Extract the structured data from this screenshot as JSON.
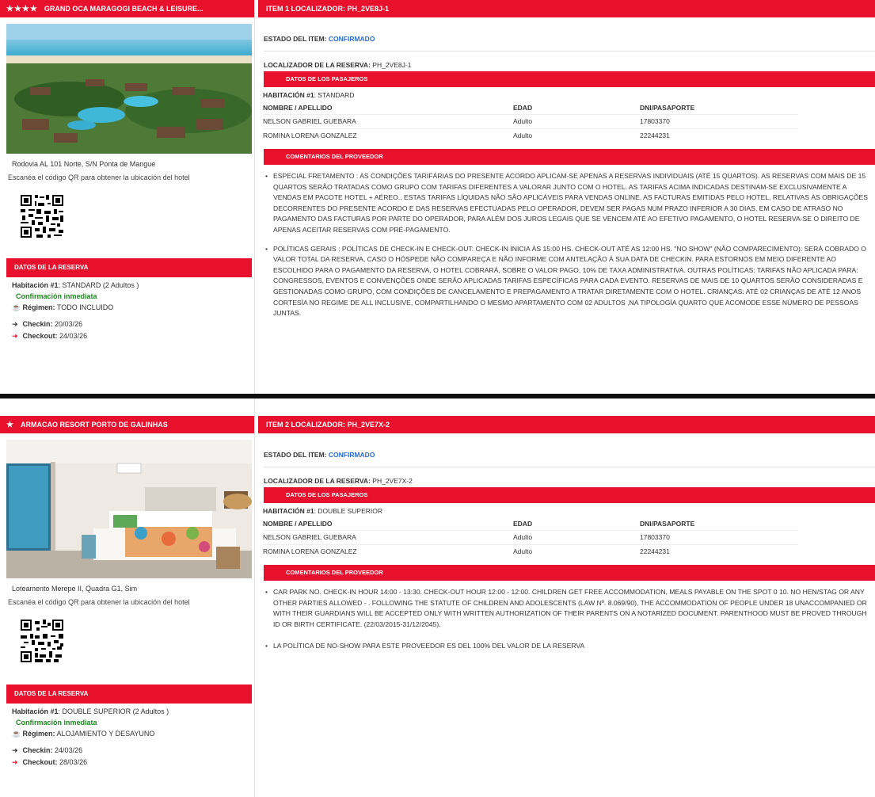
{
  "items": [
    {
      "hotel": {
        "stars": "★★★★",
        "name": "GRAND OCA MARAGOGI BEACH & LEISURE...",
        "address": "Rodovia AL 101 Norte, S/N Ponta de Mangue",
        "qr_note": "Escanéa el código QR para obtener la ubicación del hotel"
      },
      "reservation": {
        "header": "DATOS DE LA RESERVA",
        "habitacion_label": "Habitación",
        "habitacion_num": "#1",
        "habitacion_value": ": STANDARD (2 Adultos )",
        "confirmation": "Confirmación inmediata",
        "regimen_label": "Régimen:",
        "regimen_value": "TODO INCLUIDO",
        "checkin_label": "Checkin:",
        "checkin_value": "20/03/26",
        "checkout_label": "Checkout:",
        "checkout_value": "24/03/26"
      },
      "item_title": "ITEM 1 LOCALIZADOR: PH_2VE8J-1",
      "estado_label": "ESTADO DEL ITEM:",
      "estado_value": "CONFIRMADO",
      "localizador_label": "LOCALIZADOR DE LA RESERVA:",
      "localizador_value": "PH_2VE8J-1",
      "pasajeros_header": "DATOS DE LOS PASAJEROS",
      "room_label": "HABITACIÓN",
      "room_num": "#1",
      "room_value": ": STANDARD",
      "columns": [
        "NOMBRE / APELLIDO",
        "EDAD",
        "DNI/PASAPORTE"
      ],
      "passengers": [
        [
          "NELSON GABRIEL GUEBARA",
          "Adulto",
          "17803370"
        ],
        [
          "ROMINA LORENA GONZALEZ",
          "Adulto",
          "22244231"
        ]
      ],
      "comments_header": "COMENTARIOS DEL PROVEEDOR",
      "comments": [
        "ESPECIAL FRETAMENTO : AS CONDIÇÕES TARIFÁRIAS DO PRESENTE ACORDO APLICAM-SE APENAS A RESERVAS INDIVIDUAIS (ATÉ 15 QUARTOS). AS RESERVAS COM MAIS DE 15 QUARTOS SERÃO TRATADAS COMO GRUPO COM TARIFAS DIFERENTES A VALORAR JUNTO COM O HOTEL. AS TARIFAS ACIMA INDICADAS DESTINAM-SE EXCLUSIVAMENTE A VENDAS EM PACOTE HOTEL + AÉREO.. ESTAS TARIFAS LÍQUIDAS NÃO SÃO APLICÁVEIS PARA VENDAS ONLINE. AS FACTURAS EMITIDAS PELO HOTEL, RELATIVAS ÀS OBRIGAÇÕES DECORRENTES DO PRESENTE ACORDO E DAS RESERVAS EFECTUADAS PELO OPERADOR, DEVEM SER PAGAS NUM PRAZO INFERIOR A 30 DIAS. EM CASO DE ATRASO NO PAGAMENTO DAS FACTURAS POR PARTE DO OPERADOR, PARA ALÉM DOS JUROS LEGAIS QUE SE VENCEM ATÉ AO EFETIVO PAGAMENTO, O HOTEL RESERVA-SE O DIREITO DE APENAS ACEITAR RESERVAS COM PRÉ-PAGAMENTO.",
        "POLÍTICAS GERAIS : POLÍTICAS DE CHECK-IN E CHECK-OUT: CHECK-IN INICIA ÀS 15:00 HS. CHECK-OUT ATÉ AS 12:00 HS. \"NO SHOW\" (NÃO COMPARECIMENTO): SERÁ COBRADO O VALOR TOTAL DA RESERVA, CASO O HÓSPEDE NÃO COMPAREÇA E NÃO INFORME COM ANTELAÇÃO Á SUA DATA DE CHECKIN. PARA ESTORNOS EM MEIO DIFERENTE AO ESCOLHIDO PARA O PAGAMENTO DA RESERVA, O HOTEL COBRARÁ, SOBRE O VALOR PAGO, 10% DE TAXA ADMINISTRATIVA. OUTRAS POLÍTICAS: TARIFAS NÃO APLICADA PARA: CONGRESSOS, EVENTOS E CONVENÇÕES ONDE SERÃO APLICADAS TARIFAS ESPECÍFICAS PARA CADA EVENTO. RESERVAS DE MAIS DE 10 QUARTOS SERÃO CONSIDERADAS E GESTIONADAS COMO GRUPO, COM CONDIÇÕES DE CANCELAMENTO E PREPAGAMENTO A TRATAR DIRETAMENTE COM O HOTEL. CRIANÇAS: ATÉ 02 CRIANÇAS DE ATÉ 12 ANOS CORTESÍA NO REGIME DE ALL INCLUSIVE, COMPARTILHANDO O MESMO APARTAMENTO COM 02 ADULTOS ,NA TIPOLOGÍA QUARTO QUE ACOMODE ESSE NÚMERO DE PESSOAS JUNTAS."
      ]
    },
    {
      "hotel": {
        "stars": "★",
        "name": "ARMACAO RESORT PORTO DE GALINHAS",
        "address": "Loteamento Merepe II, Quadra G1, Sim",
        "qr_note": "Escanéa el código QR para obtener la ubicación del hotel"
      },
      "reservation": {
        "header": "DATOS DE LA RESERVA",
        "habitacion_label": "Habitación",
        "habitacion_num": "#1",
        "habitacion_value": ": DOUBLE SUPERIOR (2 Adultos )",
        "confirmation": "Confirmación inmediata",
        "regimen_label": "Régimen:",
        "regimen_value": "ALOJAMIENTO Y DESAYUNO",
        "checkin_label": "Checkin:",
        "checkin_value": "24/03/26",
        "checkout_label": "Checkout:",
        "checkout_value": "28/03/26"
      },
      "item_title": "ITEM 2 LOCALIZADOR: PH_2VE7X-2",
      "estado_label": "ESTADO DEL ITEM:",
      "estado_value": "CONFIRMADO",
      "localizador_label": "LOCALIZADOR DE LA RESERVA:",
      "localizador_value": "PH_2VE7X-2",
      "pasajeros_header": "DATOS DE LOS PASAJEROS",
      "room_label": "HABITACIÓN",
      "room_num": "#1",
      "room_value": ": DOUBLE SUPERIOR",
      "columns": [
        "NOMBRE / APELLIDO",
        "EDAD",
        "DNI/PASAPORTE"
      ],
      "passengers": [
        [
          "NELSON GABRIEL GUEBARA",
          "Adulto",
          "17803370"
        ],
        [
          "ROMINA LORENA GONZALEZ",
          "Adulto",
          "22244231"
        ]
      ],
      "comments_header": "COMENTARIOS DEL PROVEEDOR",
      "comments": [
        "CAR PARK NO. CHECK-IN HOUR 14:00 - 13:30. CHECK-OUT HOUR 12:00 - 12:00. CHILDREN GET FREE ACCOMMODATION, MEALS PAYABLE ON THE SPOT 0 10. NO HEN/STAG OR ANY OTHER PARTIES ALLOWED - . FOLLOWING THE STATUTE OF CHILDREN AND ADOLESCENTS (LAW Nº. 8.069/90), THE ACCOMMODATION OF PEOPLE UNDER 18 UNACCOMPANIED OR WITH THEIR GUARDIANS WILL BE ACCEPTED ONLY WITH WRITTEN AUTHORIZATION OF THEIR PARENTS ON A NOTARIZED DOCUMENT. PARENTHOOD MUST BE PROVED THROUGH ID OR BIRTH CERTIFICATE. (22/03/2015-31/12/2045).",
        "LA POLÍTICA DE NO-SHOW PARA ESTE PROVEEDOR ES DEL 100% DEL VALOR DE LA RESERVA"
      ]
    }
  ],
  "colors": {
    "accent": "#e8112d",
    "confirmed": "#2a6bd1",
    "green": "#1a8a1a"
  }
}
